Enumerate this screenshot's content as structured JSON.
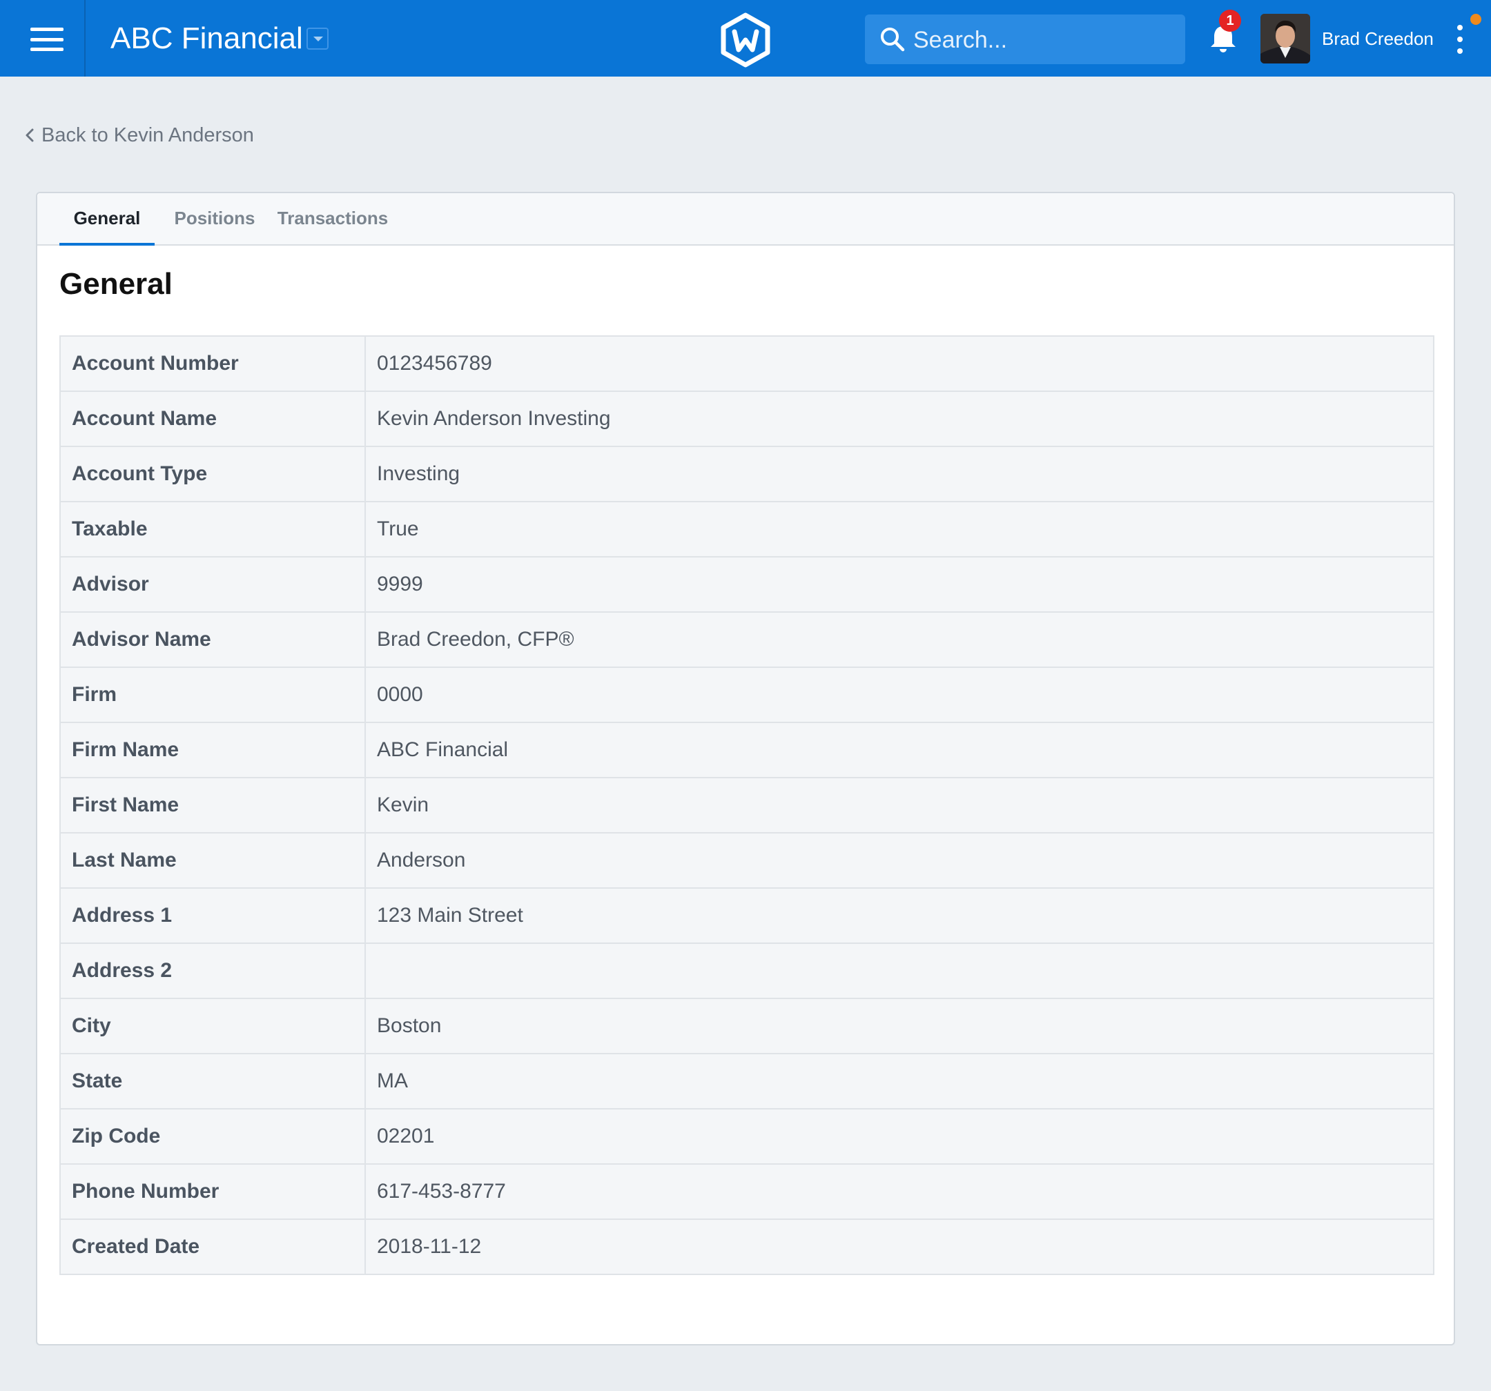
{
  "header": {
    "app_title": "ABC Financial",
    "search_placeholder": "Search...",
    "notification_count": "1",
    "user_name": "Brad Creedon"
  },
  "back_link": "Back to Kevin Anderson",
  "tabs": [
    {
      "label": "General",
      "active": true
    },
    {
      "label": "Positions",
      "active": false
    },
    {
      "label": "Transactions",
      "active": false
    }
  ],
  "section_title": "General",
  "details": [
    {
      "label": "Account Number",
      "value": "0123456789"
    },
    {
      "label": "Account Name",
      "value": "Kevin Anderson Investing"
    },
    {
      "label": "Account Type",
      "value": "Investing"
    },
    {
      "label": "Taxable",
      "value": "True"
    },
    {
      "label": "Advisor",
      "value": "9999"
    },
    {
      "label": "Advisor Name",
      "value": "Brad Creedon, CFP®"
    },
    {
      "label": "Firm",
      "value": "0000"
    },
    {
      "label": "Firm Name",
      "value": "ABC Financial"
    },
    {
      "label": "First Name",
      "value": "Kevin"
    },
    {
      "label": "Last Name",
      "value": "Anderson"
    },
    {
      "label": "Address 1",
      "value": "123 Main Street"
    },
    {
      "label": "Address 2",
      "value": ""
    },
    {
      "label": "City",
      "value": "Boston"
    },
    {
      "label": "State",
      "value": "MA"
    },
    {
      "label": "Zip Code",
      "value": "02201"
    },
    {
      "label": "Phone Number",
      "value": "617-453-8777"
    },
    {
      "label": "Created Date",
      "value": "2018-11-12"
    }
  ],
  "colors": {
    "brand_blue": "#0a75d6",
    "badge_red": "#e42424",
    "status_orange": "#f08a1c",
    "page_bg": "#e9edf1"
  },
  "icons": [
    "menu-icon",
    "chevron-down-icon",
    "app-logo-icon",
    "search-icon",
    "bell-icon",
    "kebab-menu-icon",
    "chevron-left-icon"
  ]
}
